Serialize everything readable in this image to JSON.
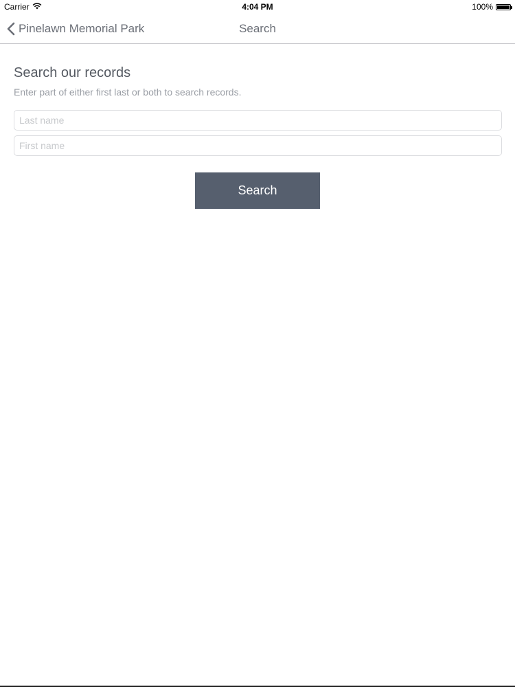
{
  "status_bar": {
    "carrier": "Carrier",
    "time": "4:04 PM",
    "battery": "100%",
    "battery_level": 1.0,
    "wifi_icon": "wifi-icon",
    "battery_icon": "battery-icon"
  },
  "nav": {
    "back_label": "Pinelawn Memorial Park",
    "back_icon": "chevron-left-icon",
    "title": "Search"
  },
  "form": {
    "heading": "Search our records",
    "subheading": "Enter part of either first last or both to search records.",
    "last_name": {
      "value": "",
      "placeholder": "Last name"
    },
    "first_name": {
      "value": "",
      "placeholder": "First name"
    },
    "search_label": "Search"
  },
  "colors": {
    "button_bg": "#565f6e",
    "button_text": "#ffffff",
    "nav_text": "#6b6f77",
    "heading_text": "#555a62",
    "subheading_text": "#9a9ea5"
  }
}
